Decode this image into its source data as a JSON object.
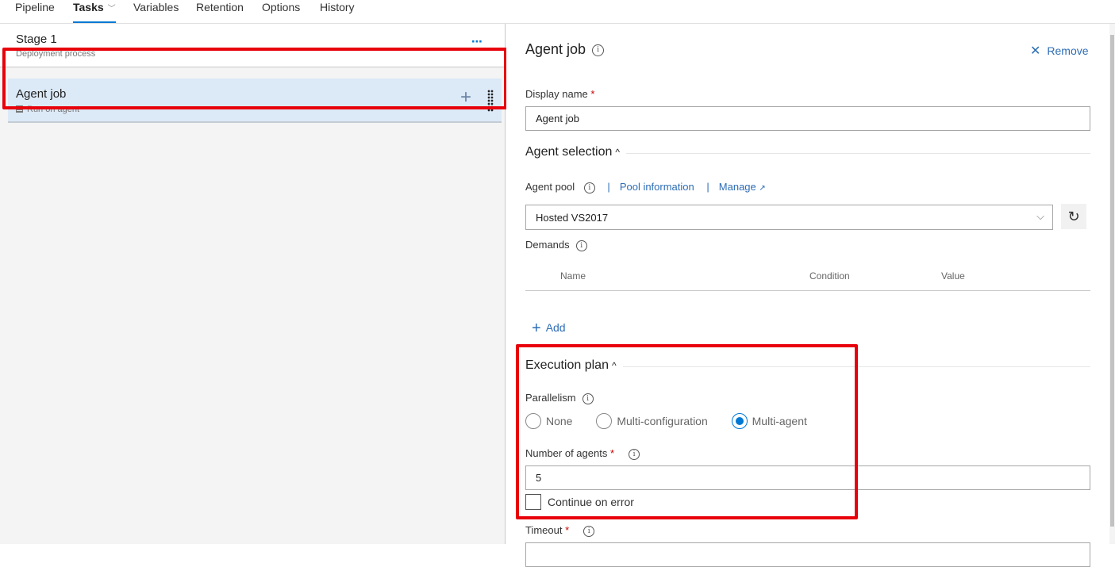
{
  "tabs": [
    {
      "label": "Pipeline",
      "active": false
    },
    {
      "label": "Tasks",
      "active": true,
      "has_dropdown": true
    },
    {
      "label": "Variables",
      "active": false
    },
    {
      "label": "Retention",
      "active": false
    },
    {
      "label": "Options",
      "active": false
    },
    {
      "label": "History",
      "active": false
    }
  ],
  "stage": {
    "title": "Stage 1",
    "subtitle": "Deployment process",
    "more_icon": "⋯"
  },
  "job": {
    "title": "Agent job",
    "subtitle": "Run on agent",
    "add_icon": "+"
  },
  "panel": {
    "title": "Agent job",
    "info_icon": "i",
    "remove_label": "Remove",
    "remove_icon": "✕",
    "display_name": {
      "label": "Display name",
      "required": "*",
      "value": "Agent job"
    },
    "agent_selection": {
      "title": "Agent selection",
      "caret": "^",
      "agent_pool_label": "Agent pool",
      "pool_info_link": "Pool information",
      "manage_link": "Manage",
      "manage_icon": "↗",
      "pool_value": "Hosted VS2017",
      "chevron": "⌵",
      "refresh_icon": "↻",
      "demands_label": "Demands",
      "demands_columns": [
        "Name",
        "Condition",
        "Value"
      ],
      "demands_rows": [],
      "add_label": "Add",
      "add_icon": "+"
    },
    "execution_plan": {
      "title": "Execution plan",
      "caret": "^",
      "parallelism_label": "Parallelism",
      "options": [
        {
          "label": "None",
          "checked": false
        },
        {
          "label": "Multi-configuration",
          "checked": false
        },
        {
          "label": "Multi-agent",
          "checked": true
        }
      ],
      "num_agents_label": "Number of agents",
      "required": "*",
      "num_agents_value": "5",
      "continue_on_error_label": "Continue on error",
      "continue_on_error_checked": false
    },
    "timeout": {
      "label": "Timeout",
      "required": "*"
    }
  }
}
